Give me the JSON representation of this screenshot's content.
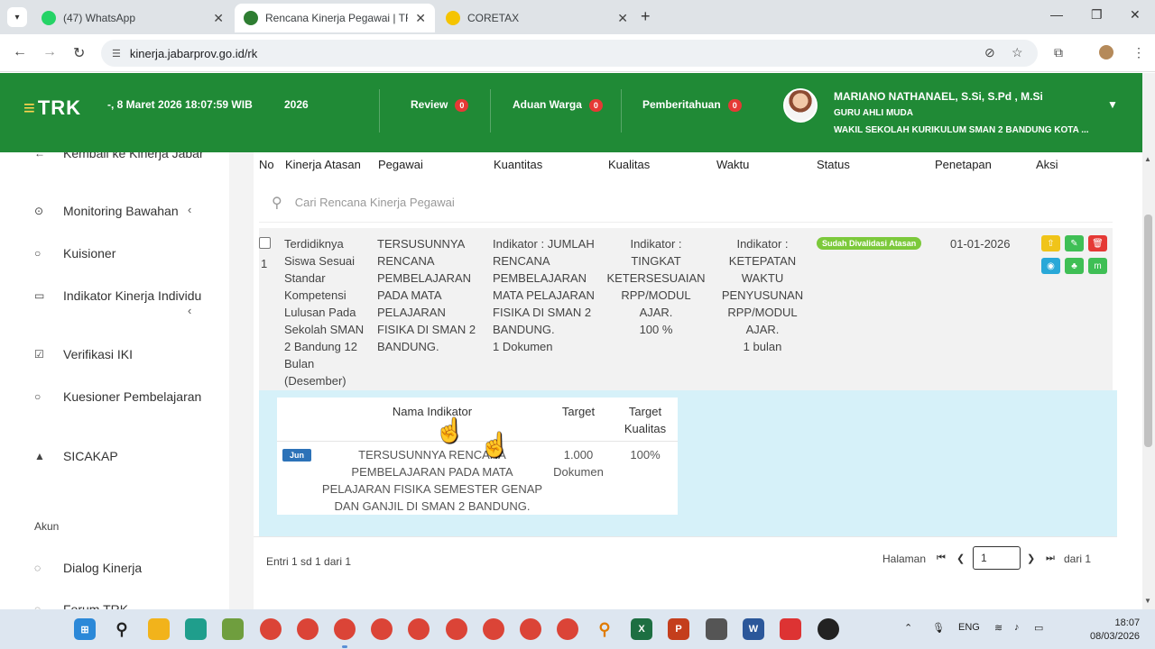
{
  "browser": {
    "tabs": [
      {
        "title": "(47) WhatsApp",
        "active": false
      },
      {
        "title": "Rencana Kinerja Pegawai | TRK",
        "active": true
      },
      {
        "title": "CORETAX",
        "active": false
      }
    ],
    "url": "kinerja.jabarprov.go.id/rk"
  },
  "header": {
    "logo": "TRK",
    "datetime": "-, 8 Maret 2026 18:07:59 WIB",
    "year": "2026",
    "review_label": "Review",
    "review_count": "0",
    "aduan_label": "Aduan Warga",
    "aduan_count": "0",
    "notif_label": "Pemberitahuan",
    "notif_count": "0",
    "user_name": "MARIANO NATHANAEL, S.Si, S.Pd , M.Si",
    "user_role": "GURU AHLI MUDA",
    "user_position": "WAKIL SEKOLAH KURIKULUM SMAN 2 BANDUNG KOTA ..."
  },
  "sidebar": {
    "items": [
      {
        "label": "Kembali ke Kinerja Jabar",
        "icon": "arrow-left-icon"
      },
      {
        "label": "Monitoring Bawahan",
        "icon": "monitoring-icon"
      },
      {
        "label": "Kuisioner",
        "icon": "chat-icon"
      },
      {
        "label": "Indikator Kinerja Individu",
        "icon": "inbox-icon"
      },
      {
        "label": "Verifikasi IKI",
        "icon": "checkbox-icon"
      },
      {
        "label": "Kuesioner Pembelajaran",
        "icon": "chat-icon"
      },
      {
        "label": "SICAKAP",
        "icon": "graduation-cap-icon"
      },
      {
        "label": "Dialog Kinerja",
        "icon": "dialog-icon"
      },
      {
        "label": "Forum TRK",
        "icon": "forum-icon"
      }
    ],
    "section_akun": "Akun"
  },
  "table": {
    "headers": {
      "no": "No",
      "kinerja_atasan": "Kinerja Atasan",
      "pegawai": "Pegawai",
      "kuantitas": "Kuantitas",
      "kualitas": "Kualitas",
      "waktu": "Waktu",
      "status": "Status",
      "penetapan": "Penetapan",
      "aksi": "Aksi"
    },
    "search_placeholder": "Cari Rencana Kinerja Pegawai",
    "row": {
      "no": "1",
      "kinerja_atasan": "Terdidiknya Siswa Sesuai Standar Kompetensi Lulusan Pada Sekolah SMAN 2 Bandung 12 Bulan (Desember)",
      "pegawai": "TERSUSUNNYA RENCANA PEMBELAJARAN PADA MATA PELAJARAN FISIKA DI SMAN 2 BANDUNG.",
      "kuantitas": "Indikator : JUMLAH RENCANA PEMBELAJARAN MATA PELAJARAN FISIKA DI SMAN 2 BANDUNG.",
      "kuantitas_target": "1 Dokumen",
      "kualitas": "Indikator : TINGKAT KETERSESUAIAN RPP/MODUL AJAR.",
      "kualitas_target": "100 %",
      "waktu": "Indikator : KETEPATAN WAKTU PENYUSUNAN RPP/MODUL AJAR.",
      "waktu_target": "1 bulan",
      "status": "Sudah Divalidasi Atasan",
      "penetapan": "01-01-2026"
    },
    "detail": {
      "headers": {
        "nama": "Nama Indikator",
        "target": "Target",
        "target_kualitas": "Target Kualitas"
      },
      "badge": "Jun",
      "nama": "TERSUSUNNYA RENCANA PEMBELAJARAN PADA MATA PELAJARAN FISIKA SEMESTER GENAP DAN GANJIL DI SMAN 2 BANDUNG.",
      "target": "1.000 Dokumen",
      "target_kualitas": "100%"
    }
  },
  "pagination": {
    "entries": "Entri 1 sd 1 dari 1",
    "halaman": "Halaman",
    "page": "1",
    "of": "dari 1"
  },
  "taskbar": {
    "lang": "ENG",
    "time": "18:07",
    "date": "08/03/2026"
  }
}
